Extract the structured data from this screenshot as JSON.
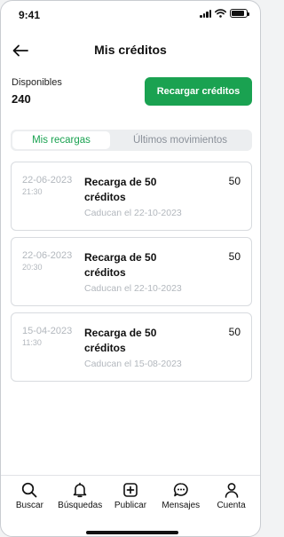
{
  "status_bar": {
    "time": "9:41",
    "battery_level": 0.9
  },
  "header": {
    "title": "Mis créditos",
    "back_icon": "arrow-left-icon"
  },
  "credits": {
    "label": "Disponibles",
    "value": "240",
    "recharge_label": "Recargar créditos"
  },
  "tabs": [
    {
      "label": "Mis recargas",
      "active": true
    },
    {
      "label": "Últimos movimientos",
      "active": false
    }
  ],
  "recharges": [
    {
      "date": "22-06-2023",
      "time": "21:30",
      "title": "Recarga de 50 créditos",
      "amount": "50",
      "expiry": "Caducan el 22-10-2023"
    },
    {
      "date": "22-06-2023",
      "time": "20:30",
      "title": "Recarga de 50 créditos",
      "amount": "50",
      "expiry": "Caducan el 22-10-2023"
    },
    {
      "date": "15-04-2023",
      "time": "11:30",
      "title": "Recarga de 50 créditos",
      "amount": "50",
      "expiry": "Caducan el 15-08-2023"
    }
  ],
  "bottom_nav": [
    {
      "label": "Buscar",
      "icon": "search-icon"
    },
    {
      "label": "Búsquedas",
      "icon": "bell-icon"
    },
    {
      "label": "Publicar",
      "icon": "plus-square-icon"
    },
    {
      "label": "Mensajes",
      "icon": "chat-icon"
    },
    {
      "label": "Cuenta",
      "icon": "user-icon"
    }
  ],
  "colors": {
    "accent": "#1aa251",
    "muted_text": "#b2b7bd",
    "border": "#d8dbdf"
  }
}
